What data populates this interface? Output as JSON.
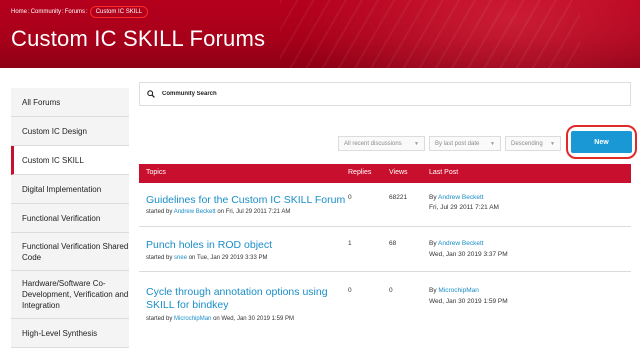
{
  "breadcrumb": {
    "items": [
      "Home",
      "Community",
      "Forums"
    ],
    "separator": ":",
    "current": "Custom IC SKILL"
  },
  "page_title": "Custom IC SKILL Forums",
  "sidebar": {
    "items": [
      {
        "label": "All Forums"
      },
      {
        "label": "Custom IC Design"
      },
      {
        "label": "Custom IC SKILL",
        "active": true
      },
      {
        "label": "Digital Implementation"
      },
      {
        "label": "Functional Verification"
      },
      {
        "label": "Functional Verification Shared Code"
      },
      {
        "label": "Hardware/Software Co-Development, Verification and Integration"
      },
      {
        "label": "High-Level Synthesis"
      }
    ]
  },
  "search": {
    "icon": "search-icon",
    "placeholder": "Community Search"
  },
  "filters": {
    "discussions": "All recent discussions",
    "sort_by": "By last post date",
    "order": "Descending"
  },
  "new_button": "New",
  "table": {
    "headers": {
      "topics": "Topics",
      "replies": "Replies",
      "views": "Views",
      "last_post": "Last Post"
    },
    "rows": [
      {
        "title": "Guidelines for the Custom IC SKILL Forum",
        "started_prefix": "started by",
        "started_user": "Andrew Beckett",
        "started_date": "on Fri, Jul 29 2011 7:21 AM",
        "replies": "0",
        "views": "68221",
        "last_by_prefix": "By",
        "last_user": "Andrew Beckett",
        "last_date": "Fri, Jul 29 2011 7:21 AM"
      },
      {
        "title": "Punch holes in ROD object",
        "started_prefix": "started by",
        "started_user": "snee",
        "started_date": "on Tue, Jan 29 2019 3:33 PM",
        "replies": "1",
        "views": "68",
        "last_by_prefix": "By",
        "last_user": "Andrew Beckett",
        "last_date": "Wed, Jan 30 2019 3:37 PM"
      },
      {
        "title_line1": "Cycle through annotation options using",
        "title_line2": "SKILL for bindkey",
        "started_prefix": "started by",
        "started_user": "MicrochipMan",
        "started_date": "on Wed, Jan 30 2019 1:59 PM",
        "replies": "0",
        "views": "0",
        "last_by_prefix": "By",
        "last_user": "MicrochipMan",
        "last_date": "Wed, Jan 30 2019 1:59 PM"
      }
    ]
  },
  "colors": {
    "brand_red": "#c8102e",
    "link_blue": "#1a8ec8",
    "button_blue": "#1a98d5",
    "highlight_ring": "#e02a2a"
  }
}
